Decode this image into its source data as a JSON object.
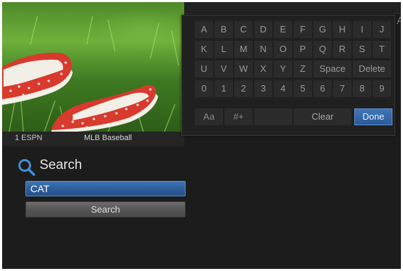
{
  "channel": {
    "number_label": "1  ESPN",
    "program": "MLB Baseball"
  },
  "search": {
    "title": "Search",
    "query": "CAT",
    "button_label": "Search"
  },
  "keyboard": {
    "rows": [
      [
        "A",
        "B",
        "C",
        "D",
        "E",
        "F",
        "G",
        "H",
        "I",
        "J"
      ],
      [
        "K",
        "L",
        "M",
        "N",
        "O",
        "P",
        "Q",
        "R",
        "S",
        "T"
      ],
      [
        "U",
        "V",
        "W",
        "X",
        "Y",
        "Z",
        "Space",
        "Delete"
      ],
      [
        "0",
        "1",
        "2",
        "3",
        "4",
        "5",
        "6",
        "7",
        "8",
        "9"
      ]
    ],
    "case_toggle": "Aa",
    "symbols_toggle": "#+",
    "clear": "Clear",
    "done": "Done"
  },
  "colors": {
    "accent": "#2f5f9d",
    "background": "#1c1c1c",
    "key": "#2b2b2b"
  }
}
